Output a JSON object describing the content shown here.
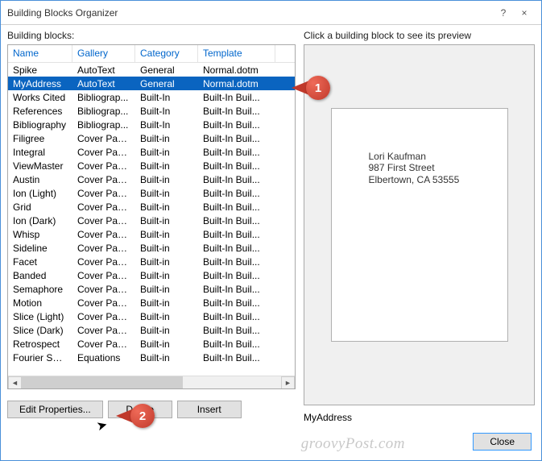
{
  "title": "Building Blocks Organizer",
  "help": "?",
  "close": "×",
  "left_label": "Building blocks:",
  "right_label": "Click a building block to see its preview",
  "headers": [
    "Name",
    "Gallery",
    "Category",
    "Template"
  ],
  "rows": [
    {
      "c": [
        "Spike",
        "AutoText",
        "General",
        "Normal.dotm"
      ],
      "sel": false
    },
    {
      "c": [
        "MyAddress",
        "AutoText",
        "General",
        "Normal.dotm"
      ],
      "sel": true
    },
    {
      "c": [
        "Works Cited",
        "Bibliograp...",
        "Built-In",
        "Built-In Buil..."
      ],
      "sel": false
    },
    {
      "c": [
        "References",
        "Bibliograp...",
        "Built-In",
        "Built-In Buil..."
      ],
      "sel": false
    },
    {
      "c": [
        "Bibliography",
        "Bibliograp...",
        "Built-In",
        "Built-In Buil..."
      ],
      "sel": false
    },
    {
      "c": [
        "Filigree",
        "Cover Pages",
        "Built-in",
        "Built-In Buil..."
      ],
      "sel": false
    },
    {
      "c": [
        "Integral",
        "Cover Pages",
        "Built-in",
        "Built-In Buil..."
      ],
      "sel": false
    },
    {
      "c": [
        "ViewMaster",
        "Cover Pages",
        "Built-in",
        "Built-In Buil..."
      ],
      "sel": false
    },
    {
      "c": [
        "Austin",
        "Cover Pages",
        "Built-in",
        "Built-In Buil..."
      ],
      "sel": false
    },
    {
      "c": [
        "Ion (Light)",
        "Cover Pages",
        "Built-in",
        "Built-In Buil..."
      ],
      "sel": false
    },
    {
      "c": [
        "Grid",
        "Cover Pages",
        "Built-in",
        "Built-In Buil..."
      ],
      "sel": false
    },
    {
      "c": [
        "Ion (Dark)",
        "Cover Pages",
        "Built-in",
        "Built-In Buil..."
      ],
      "sel": false
    },
    {
      "c": [
        "Whisp",
        "Cover Pages",
        "Built-in",
        "Built-In Buil..."
      ],
      "sel": false
    },
    {
      "c": [
        "Sideline",
        "Cover Pages",
        "Built-in",
        "Built-In Buil..."
      ],
      "sel": false
    },
    {
      "c": [
        "Facet",
        "Cover Pages",
        "Built-in",
        "Built-In Buil..."
      ],
      "sel": false
    },
    {
      "c": [
        "Banded",
        "Cover Pages",
        "Built-in",
        "Built-In Buil..."
      ],
      "sel": false
    },
    {
      "c": [
        "Semaphore",
        "Cover Pages",
        "Built-in",
        "Built-In Buil..."
      ],
      "sel": false
    },
    {
      "c": [
        "Motion",
        "Cover Pages",
        "Built-in",
        "Built-In Buil..."
      ],
      "sel": false
    },
    {
      "c": [
        "Slice (Light)",
        "Cover Pages",
        "Built-in",
        "Built-In Buil..."
      ],
      "sel": false
    },
    {
      "c": [
        "Slice (Dark)",
        "Cover Pages",
        "Built-in",
        "Built-In Buil..."
      ],
      "sel": false
    },
    {
      "c": [
        "Retrospect",
        "Cover Pages",
        "Built-in",
        "Built-In Buil..."
      ],
      "sel": false
    },
    {
      "c": [
        "Fourier Seri...",
        "Equations",
        "Built-in",
        "Built-In Buil..."
      ],
      "sel": false
    }
  ],
  "buttons": {
    "edit": "Edit Properties...",
    "delete": "Delete",
    "insert": "Insert",
    "close": "Close"
  },
  "preview_name": "MyAddress",
  "preview_lines": [
    "Lori Kaufman",
    "987 First Street",
    "Elbertown, CA 53555"
  ],
  "callouts": {
    "one": "1",
    "two": "2"
  },
  "watermark": "groovyPost.com"
}
